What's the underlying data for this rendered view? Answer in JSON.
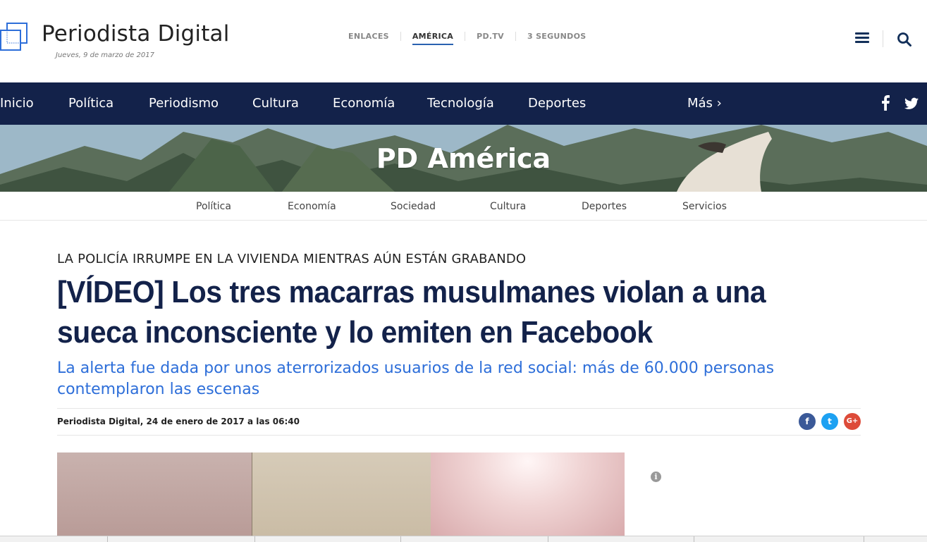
{
  "header": {
    "logo_text": "Periodista Digital",
    "date": "Jueves, 9 de marzo de 2017",
    "top_links": [
      "ENLACES",
      "AMÉRICA",
      "PD.TV",
      "3 SEGUNDOS"
    ],
    "active_top_link": "AMÉRICA"
  },
  "mainnav": {
    "items": [
      "Inicio",
      "Política",
      "Periodismo",
      "Cultura",
      "Economía",
      "Tecnología",
      "Deportes"
    ],
    "more": "Más ›"
  },
  "banner": {
    "title": "PD América"
  },
  "subnav": {
    "items": [
      "Política",
      "Economía",
      "Sociedad",
      "Cultura",
      "Deportes",
      "Servicios"
    ]
  },
  "article": {
    "kicker": "LA POLICÍA IRRUMPE EN LA VIVIENDA MIENTRAS AÚN ESTÁN GRABANDO",
    "headline": "[VÍDEO] Los tres macarras musulmanes violan a una sueca inconsciente y lo emiten en Facebook",
    "subhead": "La alerta fue dada por unos aterrorizados usuarios de la red social: más de 60.000 personas contemplaron las escenas",
    "meta": "Periodista Digital, 24 de enero de 2017 a las 06:40",
    "share": [
      {
        "label": "f",
        "color": "#3b5998"
      },
      {
        "label": "t",
        "color": "#1da1f2"
      },
      {
        "label": "G+",
        "color": "#dd4b39"
      }
    ]
  },
  "colors": {
    "navy": "#13224a",
    "accent": "#2d6ed9"
  },
  "icons": {
    "menu": "hamburger-icon",
    "search": "search-icon",
    "info": "info-icon"
  }
}
